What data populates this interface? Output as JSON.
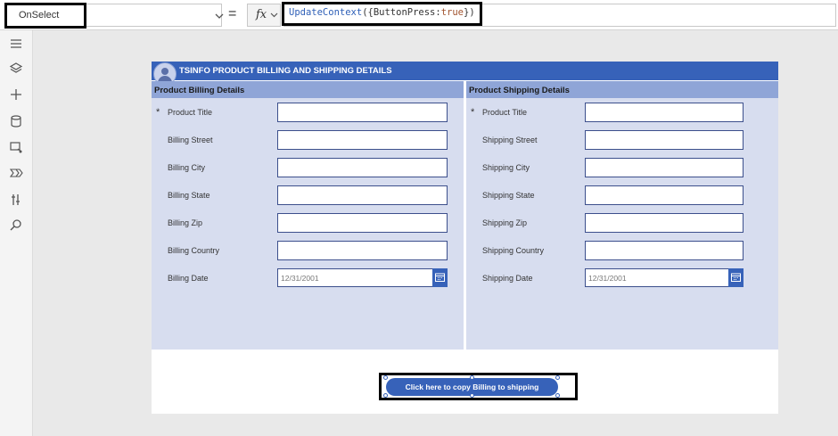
{
  "formula_bar": {
    "property": "OnSelect",
    "equals": "=",
    "fx_label": "fx",
    "formula": {
      "fn": "UpdateContext",
      "open": "({ButtonPress:",
      "value": "true",
      "close": "})"
    }
  },
  "rail": {
    "icons": [
      "hamburger-icon",
      "layers-icon",
      "plus-icon",
      "database-icon",
      "media-icon",
      "flow-icon",
      "tools-icon",
      "search-icon"
    ]
  },
  "header": {
    "title": "TSINFO PRODUCT BILLING AND SHIPPING DETAILS"
  },
  "billing": {
    "title": "Product Billing Details",
    "required_mark": "*",
    "fields": [
      {
        "label": "Product Title",
        "value": ""
      },
      {
        "label": "Billing Street",
        "value": ""
      },
      {
        "label": "Billing City",
        "value": ""
      },
      {
        "label": "Billing State",
        "value": ""
      },
      {
        "label": "Billing Zip",
        "value": ""
      },
      {
        "label": "Billing Country",
        "value": ""
      }
    ],
    "date_label": "Billing Date",
    "date_value": "12/31/2001"
  },
  "shipping": {
    "title": "Product Shipping Details",
    "required_mark": "*",
    "fields": [
      {
        "label": "Product Title",
        "value": ""
      },
      {
        "label": "Shipping Street",
        "value": ""
      },
      {
        "label": "Shipping City",
        "value": ""
      },
      {
        "label": "Shipping State",
        "value": ""
      },
      {
        "label": "Shipping Zip",
        "value": ""
      },
      {
        "label": "Shipping Country",
        "value": ""
      }
    ],
    "date_label": "Shipping Date",
    "date_value": "12/31/2001"
  },
  "copy_button": {
    "label": "Click here to copy Billing to shipping"
  },
  "colors": {
    "accent": "#3762b9",
    "panel": "#d7ddef",
    "panel_header": "#8fa5d7"
  }
}
